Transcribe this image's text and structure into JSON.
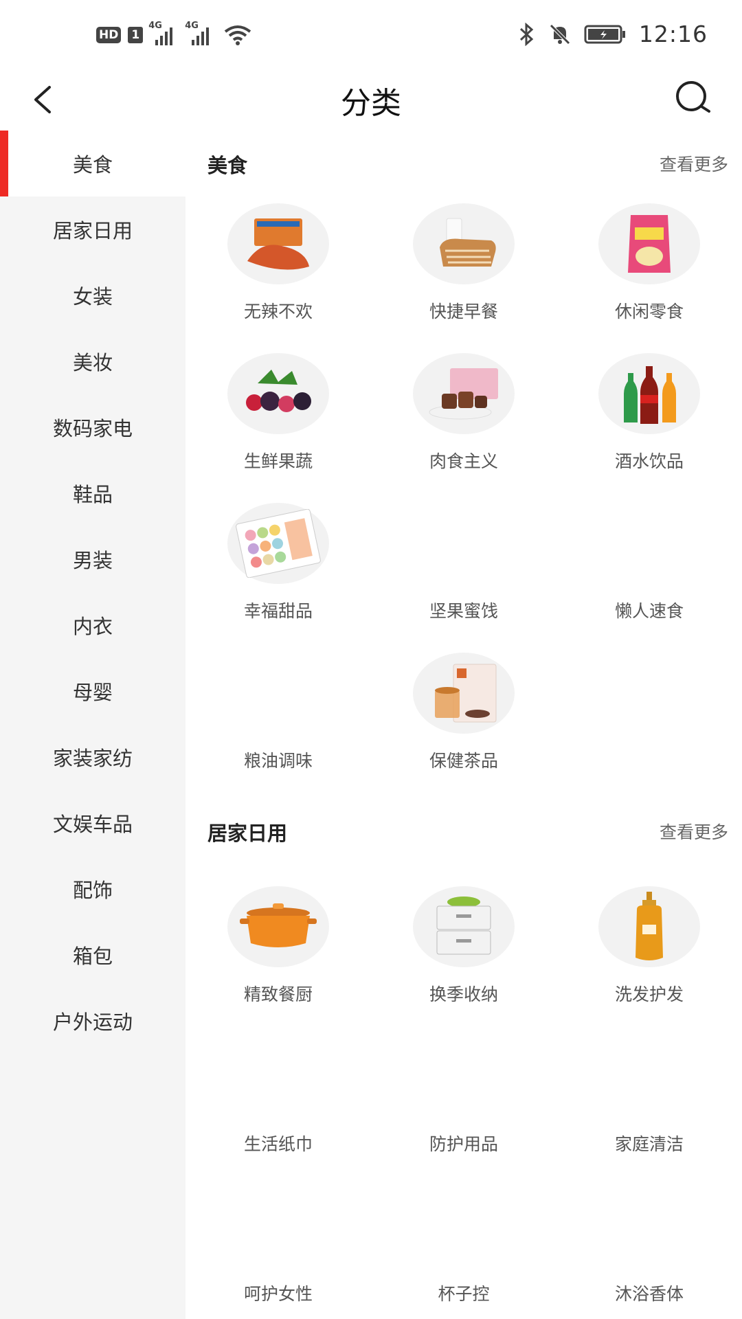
{
  "status_bar": {
    "left_badges": [
      "HD",
      "1"
    ],
    "signal_tags": [
      "4G",
      "4G"
    ],
    "time": "12:16"
  },
  "header": {
    "title": "分类"
  },
  "sidebar": {
    "items": [
      {
        "label": "美食",
        "active": true
      },
      {
        "label": "居家日用"
      },
      {
        "label": "女装"
      },
      {
        "label": "美妆"
      },
      {
        "label": "数码家电"
      },
      {
        "label": "鞋品"
      },
      {
        "label": "男装"
      },
      {
        "label": "内衣"
      },
      {
        "label": "母婴"
      },
      {
        "label": "家装家纺"
      },
      {
        "label": "文娱车品"
      },
      {
        "label": "配饰"
      },
      {
        "label": "箱包"
      },
      {
        "label": "户外运动"
      }
    ]
  },
  "sections": [
    {
      "title": "美食",
      "more": "查看更多",
      "items": [
        {
          "label": "无辣不欢",
          "icon": "spicy-snack-image"
        },
        {
          "label": "快捷早餐",
          "icon": "bread-milk-image"
        },
        {
          "label": "休闲零食",
          "icon": "chips-bag-image"
        },
        {
          "label": "生鲜果蔬",
          "icon": "berries-image"
        },
        {
          "label": "肉食主义",
          "icon": "meat-box-image"
        },
        {
          "label": "酒水饮品",
          "icon": "drink-bottles-image"
        },
        {
          "label": "幸福甜品",
          "icon": "macarons-image"
        },
        {
          "label": "坚果蜜饯",
          "icon": ""
        },
        {
          "label": "懒人速食",
          "icon": ""
        },
        {
          "label": "粮油调味",
          "icon": ""
        },
        {
          "label": "保健茶品",
          "icon": "tea-box-image"
        }
      ]
    },
    {
      "title": "居家日用",
      "more": "查看更多",
      "items": [
        {
          "label": "精致餐厨",
          "icon": "orange-pot-image"
        },
        {
          "label": "换季收纳",
          "icon": "storage-drawer-image"
        },
        {
          "label": "洗发护发",
          "icon": "shampoo-bottle-image"
        },
        {
          "label": "生活纸巾",
          "icon": ""
        },
        {
          "label": "防护用品",
          "icon": ""
        },
        {
          "label": "家庭清洁",
          "icon": ""
        },
        {
          "label": "呵护女性",
          "icon": ""
        },
        {
          "label": "杯子控",
          "icon": ""
        },
        {
          "label": "沐浴香体",
          "icon": ""
        }
      ]
    }
  ],
  "colors": {
    "accent": "#ee2a24",
    "sidebar_bg": "#f5f5f5",
    "text": "#222222",
    "muted": "#666666"
  }
}
